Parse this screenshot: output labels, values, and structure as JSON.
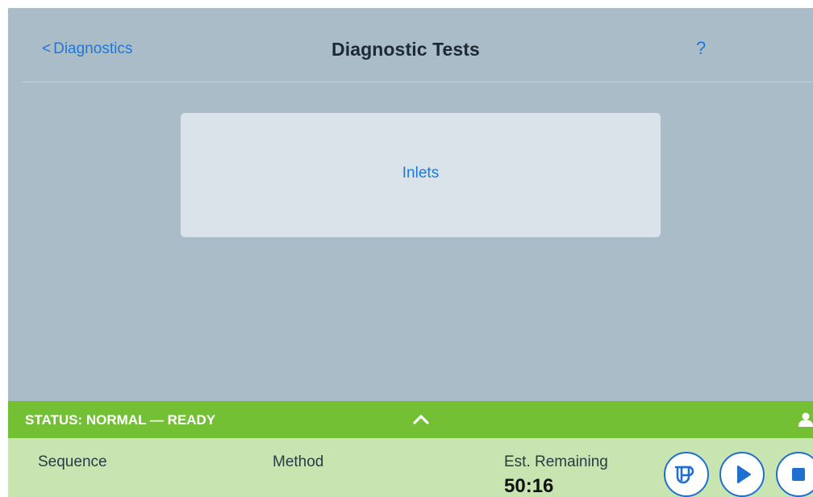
{
  "header": {
    "back_chevron": "<",
    "back_label": "Diagnostics",
    "title": "Diagnostic Tests",
    "help_label": "?"
  },
  "main": {
    "tiles": [
      {
        "label": "Inlets"
      }
    ]
  },
  "status_bar": {
    "status_text": "STATUS: NORMAL — READY",
    "expand_icon": "chevron-up-icon",
    "user_icon": "user-icon"
  },
  "status_panel": {
    "sequence_label": "Sequence",
    "method_label": "Method",
    "est_remaining_label": "Est. Remaining",
    "est_remaining_value": "50:16",
    "controls": [
      {
        "name": "sample-vial-button",
        "icon": "vial-icon"
      },
      {
        "name": "run-button",
        "icon": "play-icon"
      },
      {
        "name": "stop-button",
        "icon": "stop-icon"
      }
    ]
  },
  "colors": {
    "background": "#a9bcc7",
    "tile": "#d9e3e9",
    "accent": "#1f78d6",
    "status_green": "#74c034",
    "status_panel": "#c8e5b1"
  }
}
